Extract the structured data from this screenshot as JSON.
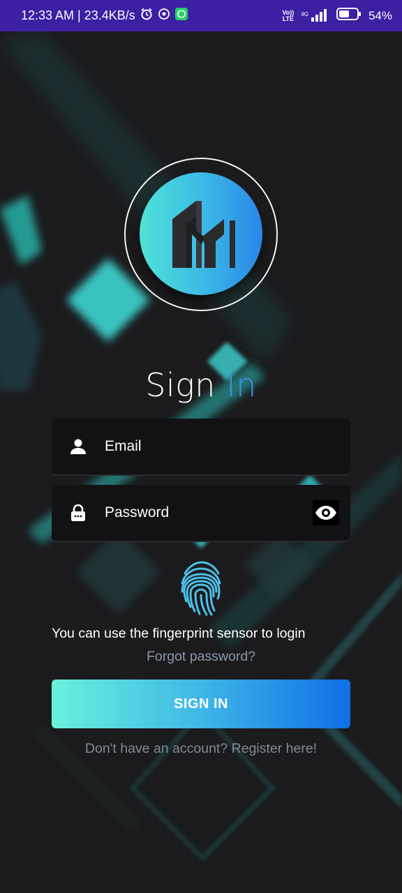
{
  "status_bar": {
    "time": "12:33 AM | 23.4KB/s",
    "volte_line1": "Vo))",
    "volte_line2": "LTE",
    "network": "4G",
    "battery": "54%"
  },
  "title": {
    "part1": "Sign ",
    "part2": "In"
  },
  "form": {
    "email_placeholder": "Email",
    "password_placeholder": "Password"
  },
  "fingerprint_hint": "You can use the fingerprint sensor to login",
  "forgot_password": "Forgot password?",
  "signin_button": "SIGN IN",
  "register_link": "Don't have an account? Register here!",
  "icons": [
    "alarm-icon",
    "vpn-icon",
    "whatsapp-icon",
    "signal-icon",
    "battery-icon",
    "user-icon",
    "lock-icon",
    "eye-icon",
    "fingerprint-icon",
    "app-logo"
  ],
  "colors": {
    "status_bar": "#3c1fa3",
    "background": "#1b1b1d",
    "accent_blue": "#3b8fe8",
    "accent_cyan": "#4fe3d7"
  }
}
